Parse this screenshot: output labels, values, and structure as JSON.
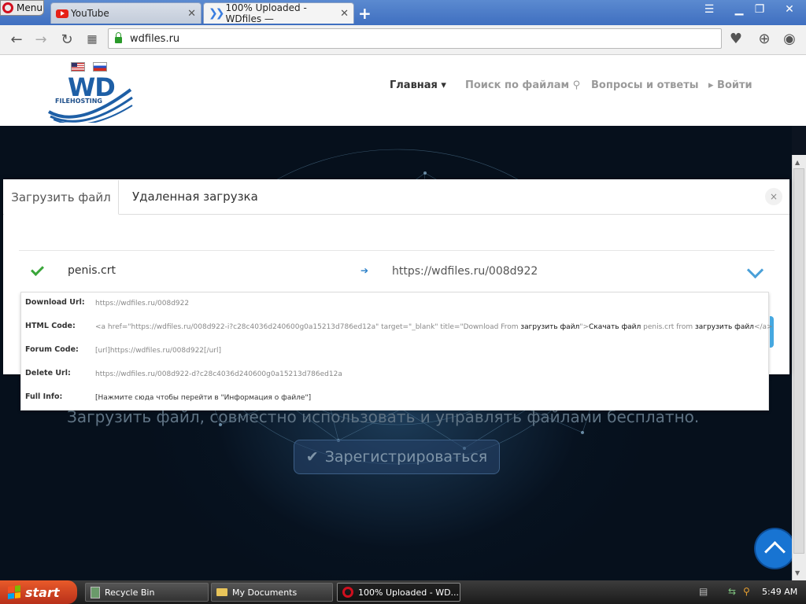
{
  "browser": {
    "menu_label": "Menu",
    "tabs": [
      {
        "label": "YouTube",
        "close": "✕"
      },
      {
        "label": "100% Uploaded - WDfiles —",
        "close": "✕"
      }
    ],
    "new_tab": "+",
    "address": "wdfiles.ru"
  },
  "site": {
    "logo_text": "WD",
    "logo_sub": "FILEHOSTING",
    "nav": {
      "home": "Главная ▾",
      "search": "Поиск по файлам ⚲",
      "faq": "Вопросы и ответы",
      "login": "▸ Войти"
    }
  },
  "modal": {
    "tab_upload": "Загрузить файл",
    "tab_remote": "Удаленная загрузка",
    "close": "×",
    "file_name": "penis.crt",
    "arrow": "➔",
    "file_url": "https://wdfiles.ru/008d922",
    "details": {
      "download_label": "Download Url:",
      "download_value": "https://wdfiles.ru/008d922",
      "html_label": "HTML Code:",
      "html_value_1": "<a href=\"https://wdfiles.ru/008d922-i?c28c4036d240600g0a15213d786ed12a\" target=\"_blank\" title=\"Download From ",
      "html_value_2": "загрузить файл",
      "html_value_3": "\">",
      "html_value_4": "Скачать файл",
      "html_value_5": " penis.crt from ",
      "html_value_6": "загрузить файл",
      "html_value_7": "</a>",
      "forum_label": "Forum Code:",
      "forum_value": "[url]https://wdfiles.ru/008d922[/url]",
      "delete_label": "Delete Url:",
      "delete_value": "https://wdfiles.ru/008d922-d?c28c4036d240600g0a15213d786ed12a",
      "info_label": "Full Info:",
      "info_value": "[Нажмите сюда чтобы перейти в \"Информация о файле\"]"
    }
  },
  "hero": {
    "tagline": "Загрузить файл, совместно использовать и управлять файлами бесплатно.",
    "register": "Зарегистрироваться"
  },
  "taskbar": {
    "start": "start",
    "items": [
      "Recycle Bin",
      "My Documents",
      "100% Uploaded - WD..."
    ],
    "clock": "5:49 AM"
  }
}
